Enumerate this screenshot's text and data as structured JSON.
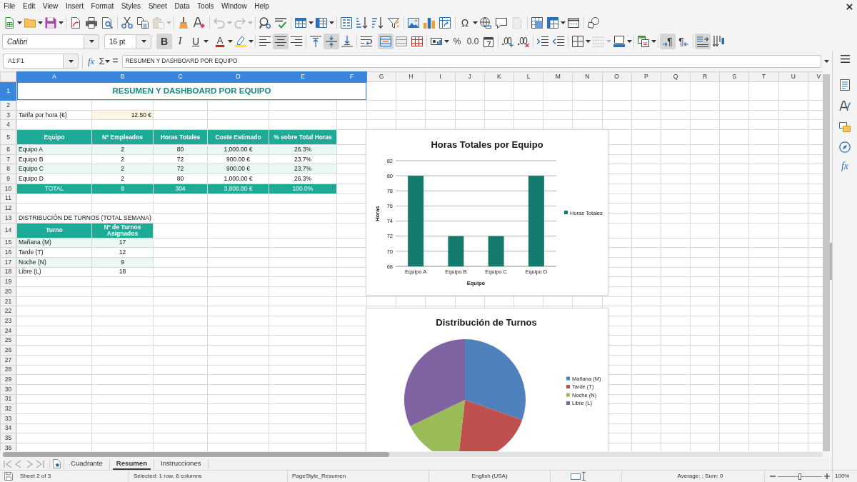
{
  "menu_bar": [
    "File",
    "Edit",
    "View",
    "Insert",
    "Format",
    "Styles",
    "Sheet",
    "Data",
    "Tools",
    "Window",
    "Help"
  ],
  "standard_toolbar": [
    {
      "disabled": false
    },
    {
      "disabled": false
    },
    {
      "disabled": false
    },
    {
      "disabled": false
    },
    {
      "disabled": false
    },
    {
      "disabled": false
    },
    {
      "disabled": false
    },
    {
      "disabled": false
    },
    {
      "disabled": true
    },
    {
      "disabled": false
    },
    {
      "disabled": false
    },
    {
      "disabled": true
    },
    {
      "disabled": true
    },
    {
      "disabled": false
    },
    {
      "disabled": false
    },
    {
      "disabled": false
    },
    {
      "disabled": false
    },
    {
      "disabled": false
    },
    {
      "disabled": false
    },
    {
      "disabled": false
    },
    {
      "disabled": false
    },
    {
      "disabled": false
    },
    {
      "disabled": false
    },
    {
      "disabled": false
    },
    {
      "label": "Ω",
      "disabled": false
    },
    {
      "disabled": false
    },
    {
      "disabled": false
    },
    {
      "disabled": true
    },
    {
      "disabled": false
    },
    {
      "disabled": false
    },
    {
      "disabled": false
    },
    {
      "disabled": false
    }
  ],
  "formatting_toolbar": {
    "font_name": "Calibri",
    "font_size": "16 pt",
    "buttons": [
      {
        "label": "B",
        "on": true,
        "disabled": false
      },
      {
        "label": "I",
        "on": false,
        "disabled": false
      },
      {
        "label": "U",
        "on": false,
        "disabled": false
      },
      {
        "label": "A",
        "on": false,
        "disabled": false
      },
      {
        "on": false,
        "disabled": false
      },
      {
        "on": false,
        "disabled": false
      },
      {
        "on": true,
        "disabled": false
      },
      {
        "on": false,
        "disabled": false
      },
      {
        "on": false,
        "disabled": false
      },
      {
        "on": true,
        "disabled": false
      },
      {
        "on": false,
        "disabled": false
      },
      {
        "on": false,
        "disabled": false
      },
      {
        "on": true,
        "disabled": false
      },
      {
        "on": false,
        "disabled": false
      },
      {
        "on": false,
        "disabled": false
      },
      {
        "on": false,
        "disabled": false
      },
      {
        "label": "%",
        "on": false,
        "disabled": false
      },
      {
        "label": "0.0",
        "on": false,
        "disabled": false
      },
      {
        "on": false,
        "disabled": false
      },
      {
        "on": false,
        "disabled": false
      },
      {
        "on": false,
        "disabled": false
      },
      {
        "on": false,
        "disabled": false
      },
      {
        "on": false,
        "disabled": false
      },
      {
        "on": false,
        "disabled": false
      },
      {
        "on": false,
        "disabled": true
      },
      {
        "on": false,
        "disabled": false
      },
      {
        "on": false,
        "disabled": false
      },
      {
        "label": "¶",
        "on": true,
        "disabled": false
      },
      {
        "label": "¶",
        "on": false,
        "disabled": false
      },
      {
        "on": true,
        "disabled": false
      },
      {
        "on": false,
        "disabled": false
      }
    ]
  },
  "formula_bar": {
    "name_box": "A1:F1",
    "function_wizard": "fx",
    "sum": "Σ",
    "equals": "=",
    "content": "RESUMEN Y DASHBOARD POR EQUIPO"
  },
  "sheet": {
    "columns": [
      {
        "label": "A",
        "selected": true
      },
      {
        "label": "B",
        "selected": true
      },
      {
        "label": "C",
        "selected": true
      },
      {
        "label": "D",
        "selected": true
      },
      {
        "label": "E",
        "selected": true
      },
      {
        "label": "F",
        "selected": true
      },
      {
        "label": "G",
        "selected": false
      },
      {
        "label": "H",
        "selected": false
      },
      {
        "label": "I",
        "selected": false
      },
      {
        "label": "J",
        "selected": false
      },
      {
        "label": "K",
        "selected": false
      },
      {
        "label": "L",
        "selected": false
      },
      {
        "label": "M",
        "selected": false
      },
      {
        "label": "N",
        "selected": false
      },
      {
        "label": "O",
        "selected": false
      },
      {
        "label": "P",
        "selected": false
      },
      {
        "label": "Q",
        "selected": false
      },
      {
        "label": "R",
        "selected": false
      },
      {
        "label": "S",
        "selected": false
      },
      {
        "label": "T",
        "selected": false
      },
      {
        "label": "U",
        "selected": false
      },
      {
        "label": "V",
        "selected": false
      }
    ],
    "rows": [
      {
        "label": "1",
        "selected": true
      },
      {
        "label": "2",
        "selected": false
      },
      {
        "label": "3",
        "selected": false
      },
      {
        "label": "4",
        "selected": false
      },
      {
        "label": "5",
        "selected": false
      },
      {
        "label": "6",
        "selected": false
      },
      {
        "label": "7",
        "selected": false
      },
      {
        "label": "8",
        "selected": false
      },
      {
        "label": "9",
        "selected": false
      },
      {
        "label": "10",
        "selected": false
      },
      {
        "label": "11",
        "selected": false
      },
      {
        "label": "12",
        "selected": false
      },
      {
        "label": "13",
        "selected": false
      },
      {
        "label": "14",
        "selected": false
      },
      {
        "label": "15",
        "selected": false
      },
      {
        "label": "16",
        "selected": false
      },
      {
        "label": "17",
        "selected": false
      },
      {
        "label": "18",
        "selected": false
      },
      {
        "label": "19",
        "selected": false
      },
      {
        "label": "20",
        "selected": false
      },
      {
        "label": "21",
        "selected": false
      },
      {
        "label": "22",
        "selected": false
      },
      {
        "label": "23",
        "selected": false
      },
      {
        "label": "24",
        "selected": false
      },
      {
        "label": "25",
        "selected": false
      },
      {
        "label": "26",
        "selected": false
      },
      {
        "label": "27",
        "selected": false
      },
      {
        "label": "28",
        "selected": false
      },
      {
        "label": "29",
        "selected": false
      },
      {
        "label": "30",
        "selected": false
      },
      {
        "label": "31",
        "selected": false
      },
      {
        "label": "32",
        "selected": false
      },
      {
        "label": "33",
        "selected": false
      },
      {
        "label": "34",
        "selected": false
      },
      {
        "label": "35",
        "selected": false
      },
      {
        "label": "36",
        "selected": false
      }
    ],
    "title": "RESUMEN Y DASHBOARD POR EQUIPO",
    "rate": {
      "label": "Tarifa por hora (€)",
      "value": "12.50 €"
    },
    "teams": {
      "header": [
        "Equipo",
        "Nº Empleados",
        "Horas Totales",
        "Coste Estimado",
        "% sobre Total Horas"
      ],
      "rows": [
        [
          "Equipo A",
          "2",
          "80",
          "1,000.00 €",
          "26.3%"
        ],
        [
          "Equipo B",
          "2",
          "72",
          "900.00 €",
          "23.7%"
        ],
        [
          "Equipo C",
          "2",
          "72",
          "900.00 €",
          "23.7%"
        ],
        [
          "Equipo D",
          "2",
          "80",
          "1,000.00 €",
          "26.3%"
        ]
      ],
      "total": [
        "TOTAL",
        "8",
        "304",
        "3,800.00 €",
        "100.0%"
      ]
    },
    "shifts": {
      "title": "DISTRIBUCIÓN DE TURNOS (TOTAL SEMANA)",
      "header": [
        "Turno",
        "Nº de Turnos Asignados"
      ],
      "rows": [
        [
          "Mañana (M)",
          "17"
        ],
        [
          "Tarde (T)",
          "12"
        ],
        [
          "Noche (N)",
          "9"
        ],
        [
          "Libre (L)",
          "18"
        ]
      ]
    }
  },
  "charts": [
    {
      "chart_data": {
        "type": "bar",
        "title": "Horas Totales por Equipo",
        "xlabel": "Equipo",
        "ylabel": "Horas",
        "categories": [
          "Equipo A",
          "Equipo B",
          "Equipo C",
          "Equipo D"
        ],
        "series": [
          {
            "name": "Horas Totales",
            "color": "#137a6d",
            "values": [
              80,
              72,
              72,
              80
            ]
          }
        ],
        "ylim": [
          68,
          82
        ],
        "yticks": [
          {
            "value": 68,
            "label": "68"
          },
          {
            "value": 70,
            "label": "70"
          },
          {
            "value": 72,
            "label": "72"
          },
          {
            "value": 74,
            "label": "74"
          },
          {
            "value": 76,
            "label": "76"
          },
          {
            "value": 78,
            "label": "78"
          },
          {
            "value": 80,
            "label": "80"
          },
          {
            "value": 82,
            "label": "82"
          }
        ],
        "grid": true,
        "legend": true
      }
    },
    {
      "chart_data": {
        "type": "pie",
        "title": "Distribución de Turnos",
        "categories": [
          "Mañana (M)",
          "Tarde (T)",
          "Noche (N)",
          "Libre (L)"
        ],
        "values": [
          30.36,
          21.43,
          16.07,
          32.14
        ],
        "colors": [
          "#4f81bd",
          "#c0504d",
          "#9bbb59",
          "#8064a2"
        ],
        "legend": true
      }
    }
  ],
  "sheet_tabs": [
    {
      "label": "Cuadrante",
      "selected": false
    },
    {
      "label": "Resumen",
      "selected": true
    },
    {
      "label": "Instrucciones",
      "selected": false
    }
  ],
  "sidebar": {
    "functions": "fx"
  },
  "status_bar": {
    "sheet": "Sheet 2 of 3",
    "selection": "Selected: 1 row, 6 columns",
    "page_style": "PageStyle_Resumen",
    "language": "English (USA)",
    "summary": "Average: ; Sum: 0",
    "zoom": {
      "level": 0.5,
      "reading": "100%"
    }
  }
}
